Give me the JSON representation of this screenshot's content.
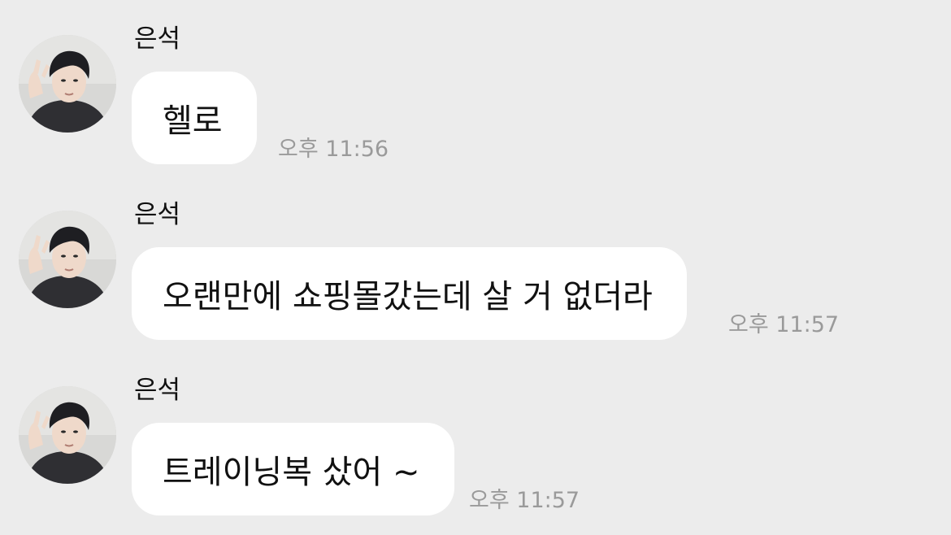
{
  "chat": {
    "messages": [
      {
        "sender": "은석",
        "text": "헬로",
        "time": "오후 11:56",
        "avatar_icon": "profile-photo"
      },
      {
        "sender": "은석",
        "text": "오랜만에 쇼핑몰갔는데 살 거 없더라",
        "time": "오후 11:57",
        "avatar_icon": "profile-photo"
      },
      {
        "sender": "은석",
        "text": "트레이닝복 샀어 ~",
        "time": "오후 11:57",
        "avatar_icon": "profile-photo"
      }
    ]
  },
  "colors": {
    "background": "#ececec",
    "bubble": "#ffffff",
    "timestamp": "#9a9a9a",
    "text": "#111111"
  }
}
